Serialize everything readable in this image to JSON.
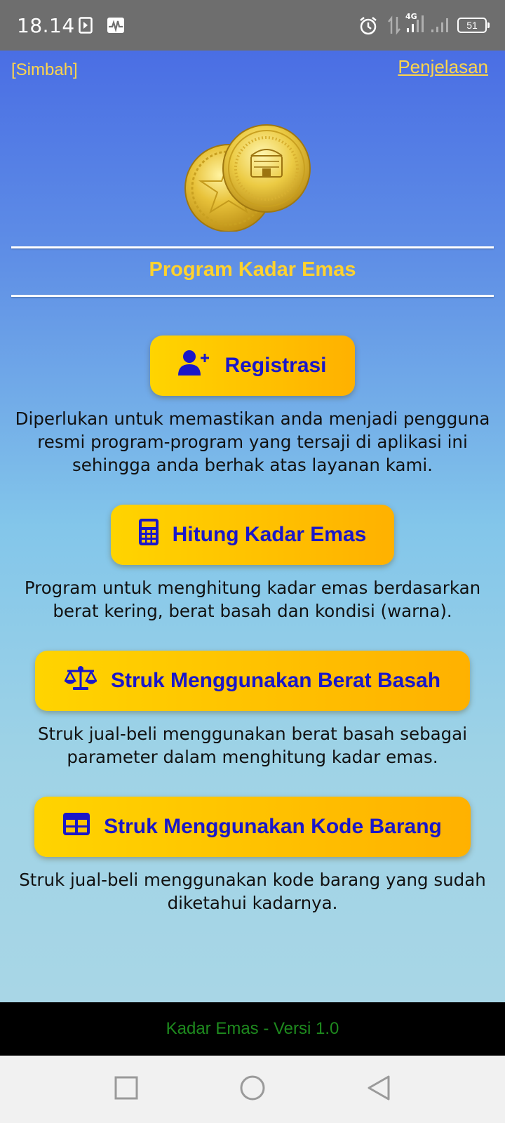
{
  "status_bar": {
    "time": "18.14",
    "network": "4G",
    "battery": "51",
    "icons": [
      "play-notification-icon",
      "activity-icon",
      "alarm-icon",
      "data-arrows-icon",
      "signal-icon",
      "signal-icon",
      "battery-icon"
    ]
  },
  "header": {
    "left_link": "[Simbah]",
    "right_link": "Penjelasan"
  },
  "title": "Program Kadar Emas",
  "sections": [
    {
      "button_label": "Registrasi",
      "icon": "user-plus-icon",
      "description": "Diperlukan untuk memastikan anda menjadi pengguna resmi program-program yang tersaji di aplikasi ini sehingga anda berhak atas layanan kami."
    },
    {
      "button_label": "Hitung Kadar Emas",
      "icon": "calculator-icon",
      "description": "Program untuk menghitung kadar emas berdasarkan berat kering, berat basah dan kondisi (warna)."
    },
    {
      "button_label": "Struk Menggunakan Berat Basah",
      "icon": "balance-scale-icon",
      "description": "Struk jual-beli menggunakan berat basah sebagai parameter dalam menghitung kadar emas."
    },
    {
      "button_label": "Struk Menggunakan Kode Barang",
      "icon": "table-icon",
      "description": "Struk jual-beli menggunakan kode barang yang sudah diketahui kadarnya."
    }
  ],
  "footer": "Kadar Emas - Versi 1.0",
  "colors": {
    "accent_text": "#ffd54a",
    "button_text": "#1a17c9",
    "button_gradient_start": "#ffd400",
    "button_gradient_end": "#ffb100",
    "footer_text": "#1e8a1e"
  }
}
